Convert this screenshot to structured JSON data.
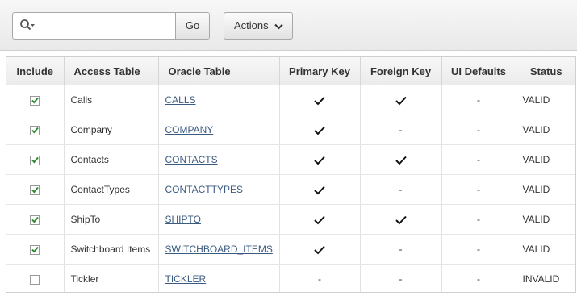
{
  "toolbar": {
    "search_value": "",
    "go_label": "Go",
    "actions_label": "Actions"
  },
  "table": {
    "headers": [
      "Include",
      "Access Table",
      "Oracle Table",
      "Primary Key",
      "Foreign Key",
      "UI Defaults",
      "Status"
    ],
    "rows": [
      {
        "include": true,
        "access_table": "Calls",
        "oracle_table": "CALLS",
        "primary_key": true,
        "foreign_key": true,
        "ui_defaults": "-",
        "status": "VALID"
      },
      {
        "include": true,
        "access_table": "Company",
        "oracle_table": "COMPANY",
        "primary_key": true,
        "foreign_key": false,
        "ui_defaults": "-",
        "status": "VALID"
      },
      {
        "include": true,
        "access_table": "Contacts",
        "oracle_table": "CONTACTS",
        "primary_key": true,
        "foreign_key": true,
        "ui_defaults": "-",
        "status": "VALID"
      },
      {
        "include": true,
        "access_table": "ContactTypes",
        "oracle_table": "CONTACTTYPES",
        "primary_key": true,
        "foreign_key": false,
        "ui_defaults": "-",
        "status": "VALID"
      },
      {
        "include": true,
        "access_table": "ShipTo",
        "oracle_table": "SHIPTO",
        "primary_key": true,
        "foreign_key": true,
        "ui_defaults": "-",
        "status": "VALID"
      },
      {
        "include": true,
        "access_table": "Switchboard Items",
        "oracle_table": "SWITCHBOARD_ITEMS",
        "primary_key": true,
        "foreign_key": false,
        "ui_defaults": "-",
        "status": "VALID"
      },
      {
        "include": false,
        "access_table": "Tickler",
        "oracle_table": "TICKLER",
        "primary_key": false,
        "foreign_key": false,
        "ui_defaults": "-",
        "status": "INVALID"
      }
    ],
    "empty_mark": "-",
    "check_color": "#2e8b2e"
  }
}
